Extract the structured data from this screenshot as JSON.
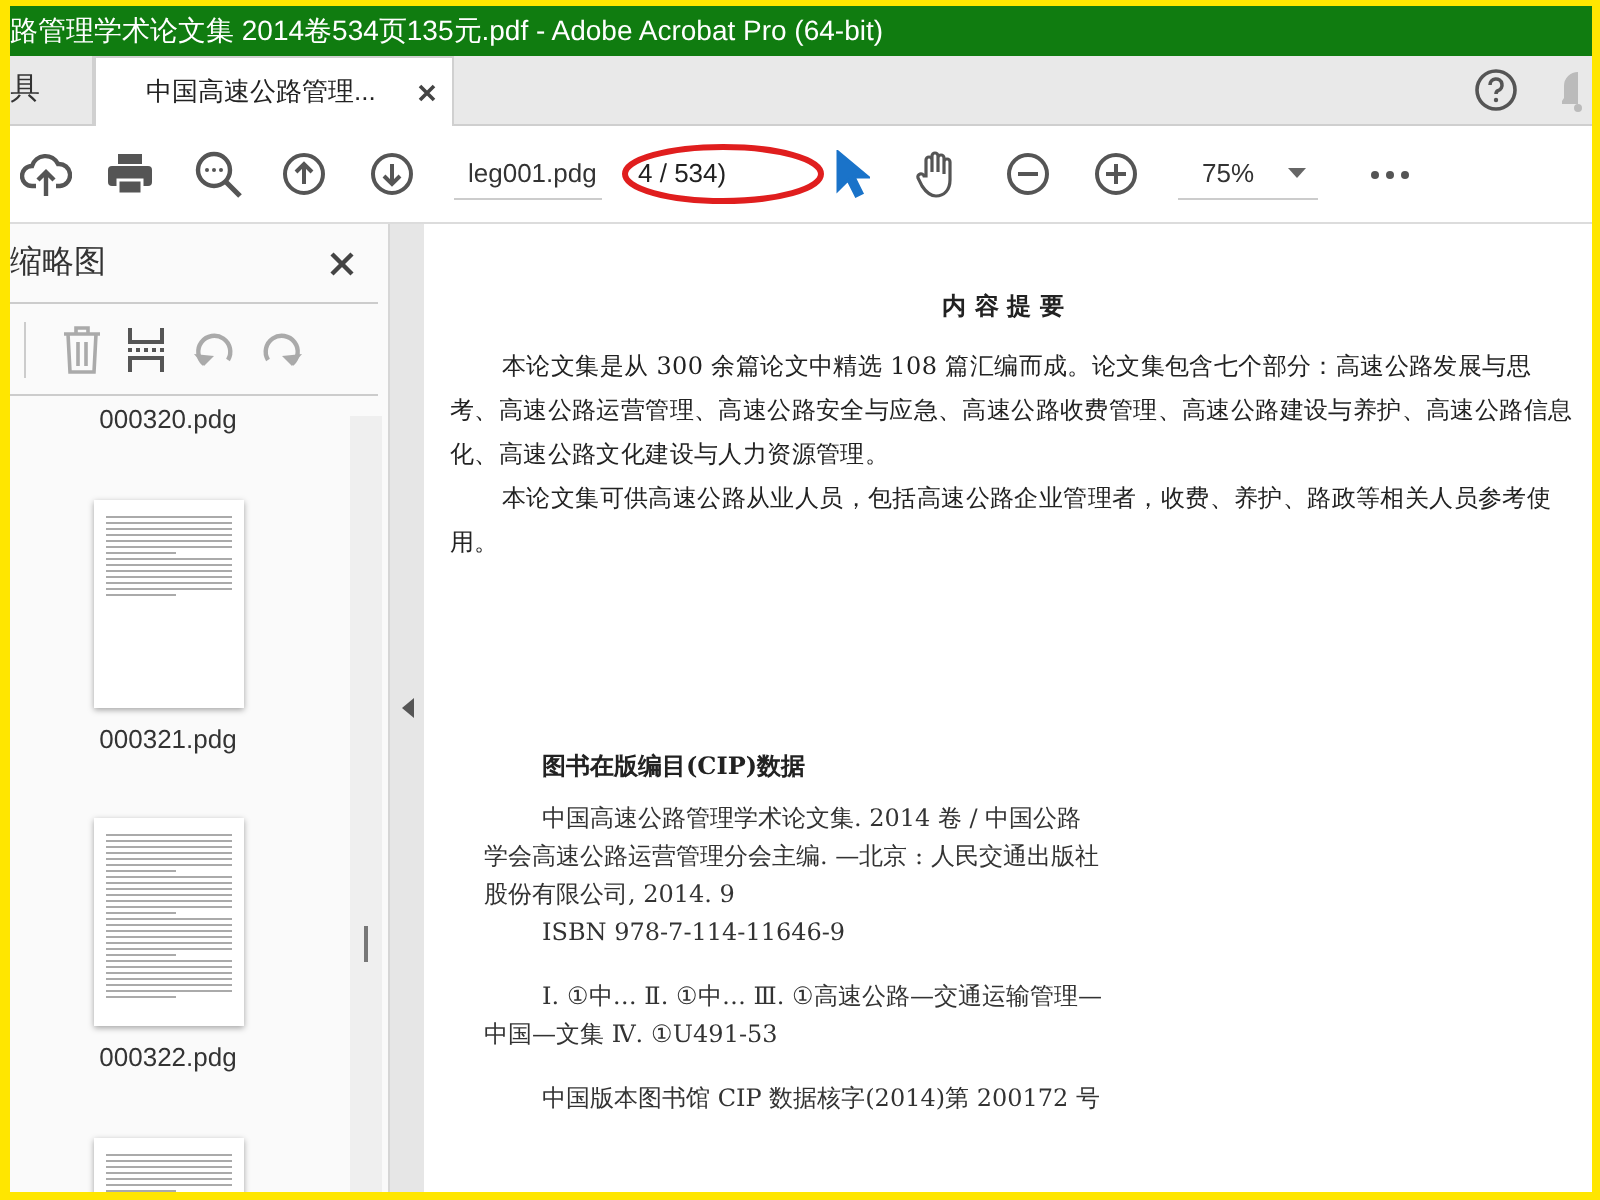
{
  "window": {
    "title": "路管理学术论文集 2014卷534页135元.pdf - Adobe Acrobat Pro (64-bit)"
  },
  "tabs": [
    {
      "label": "具",
      "selected": false
    },
    {
      "label": "中国高速公路管理...",
      "selected": true
    }
  ],
  "toolbar": {
    "page_name": "leg001.pdg",
    "page_number": "4 / 534)",
    "zoom": "75%",
    "tools": [
      {
        "kind": "select",
        "selected": true
      },
      {
        "kind": "hand",
        "selected": false
      }
    ]
  },
  "sidebar": {
    "title": "缩略图",
    "thumbnails": [
      {
        "label": "000320.pdg"
      },
      {
        "label": "000321.pdg"
      },
      {
        "label": "000322.pdg"
      }
    ]
  },
  "document": {
    "heading": "内 容 提 要",
    "paragraphs": [
      "本论文集是从 300 余篇论文中精选 108 篇汇编而成。论文集包含七个部分：高速公路发展与思考、高速公路运营管理、高速公路安全与应急、高速公路收费管理、高速公路建设与养护、高速公路信息化、高速公路文化建设与人力资源管理。",
      "本论文集可供高速公路从业人员，包括高速公路企业管理者，收费、养护、路政等相关人员参考使用。"
    ],
    "cip_heading": "图书在版编目(CIP)数据",
    "cip_paragraphs": [
      "中国高速公路管理学术论文集. 2014 卷 / 中国公路学会高速公路运营管理分会主编. —北京 : 人民交通出版社股份有限公司, 2014. 9",
      "ISBN 978-7-114-11646-9",
      "Ⅰ. ①中… Ⅱ. ①中… Ⅲ. ①高速公路—交通运输管理—中国—文集 Ⅳ. ①U491-53",
      "中国版本图书馆 CIP 数据核字(2014)第 200172 号"
    ]
  }
}
